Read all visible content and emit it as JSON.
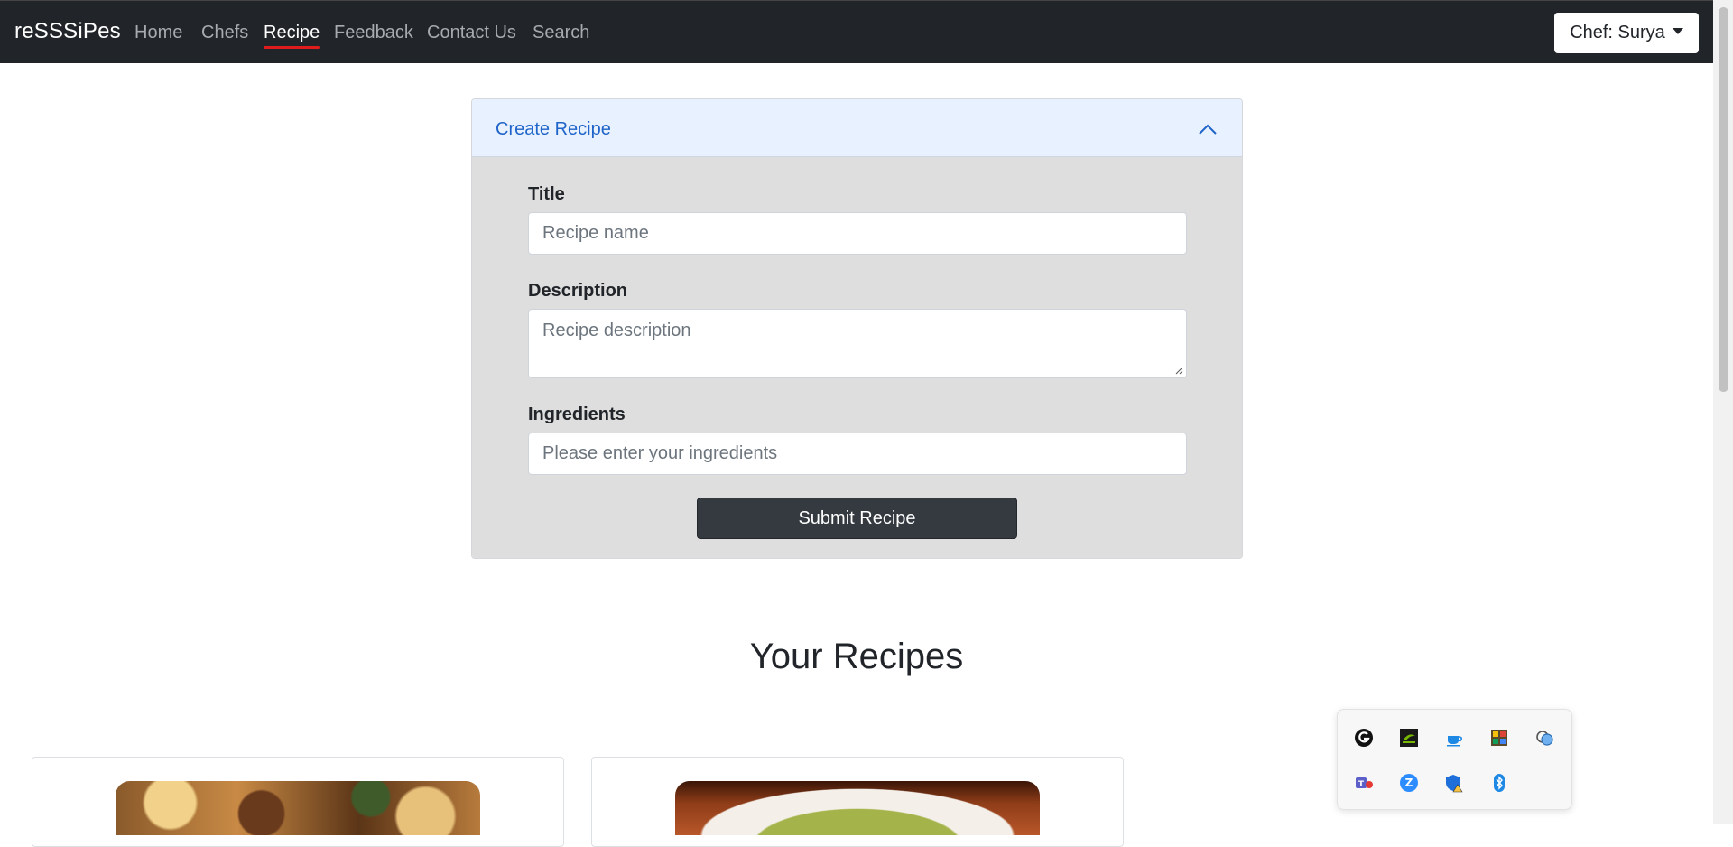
{
  "navbar": {
    "brand": "reSSSiPes",
    "links": [
      {
        "label": "Home"
      },
      {
        "label": "Chefs"
      },
      {
        "label": "Recipe"
      },
      {
        "label": "Feedback"
      },
      {
        "label": "Contact Us"
      },
      {
        "label": "Search"
      }
    ],
    "active_link": "Recipe",
    "account_button": "Chef: Surya"
  },
  "create_recipe": {
    "header": "Create Recipe",
    "title_label": "Title",
    "title_placeholder": "Recipe name",
    "description_label": "Description",
    "description_placeholder": "Recipe description",
    "ingredients_label": "Ingredients",
    "ingredients_placeholder": "Please enter your ingredients",
    "submit_label": "Submit Recipe"
  },
  "your_recipes": {
    "heading": "Your Recipes"
  },
  "tray": {
    "icons": [
      "logitech-g-hub-icon",
      "nvidia-icon",
      "java-icon",
      "app-grid-icon",
      "cloud-sync-icon",
      "teams-icon",
      "zoom-icon",
      "security-warning-icon",
      "bluetooth-icon"
    ]
  },
  "colors": {
    "navbar_bg": "#212529",
    "active_underline": "#e01b1b",
    "accordion_header_bg": "#e7f1ff",
    "accordion_title": "#1f64c8",
    "form_bg": "#dedede",
    "submit_bg": "#343a40"
  }
}
